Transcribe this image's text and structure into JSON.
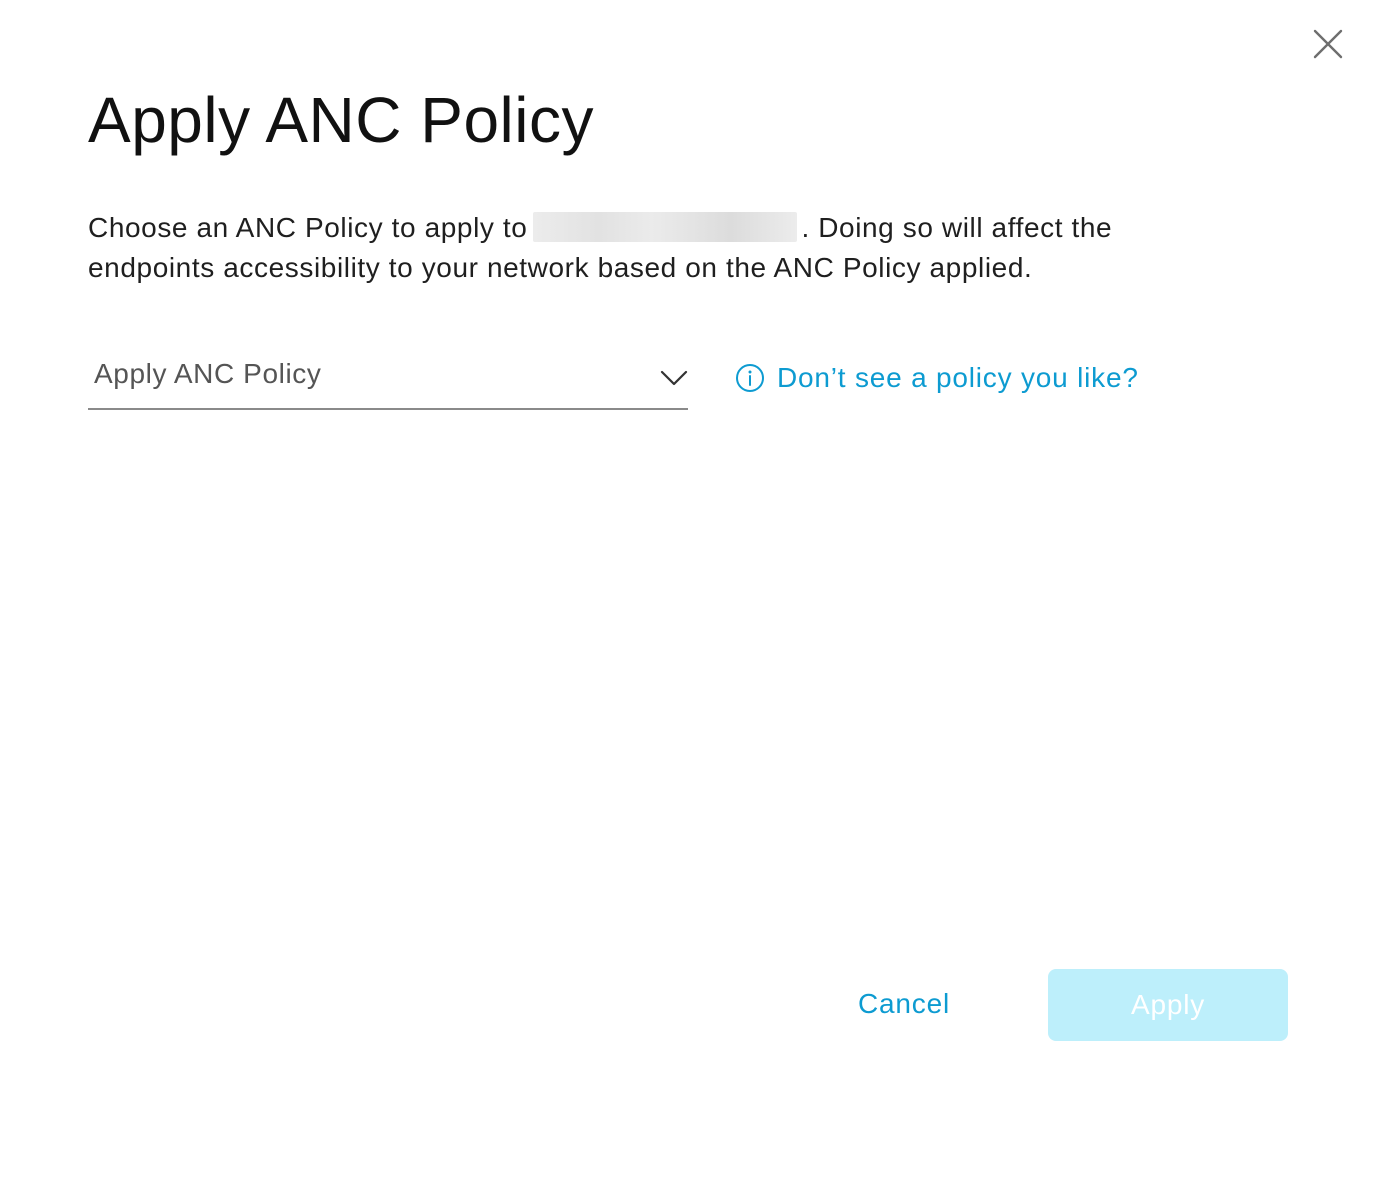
{
  "dialog": {
    "title": "Apply ANC Policy",
    "description_before": "Choose an ANC Policy to apply to",
    "description_after": ". Doing so will affect the endpoints accessibility to your network based on the ANC Policy applied.",
    "close_icon": "close-icon"
  },
  "policy_select": {
    "value": "Apply ANC Policy",
    "icon": "chevron-down-icon"
  },
  "help_link": {
    "icon": "info-icon",
    "label": "Don’t see a policy you like?"
  },
  "footer": {
    "cancel_label": "Cancel",
    "apply_label": "Apply"
  },
  "colors": {
    "accent": "#0d9bd1",
    "apply_disabled_bg": "#bdeffb",
    "text": "#1f1f1f"
  }
}
